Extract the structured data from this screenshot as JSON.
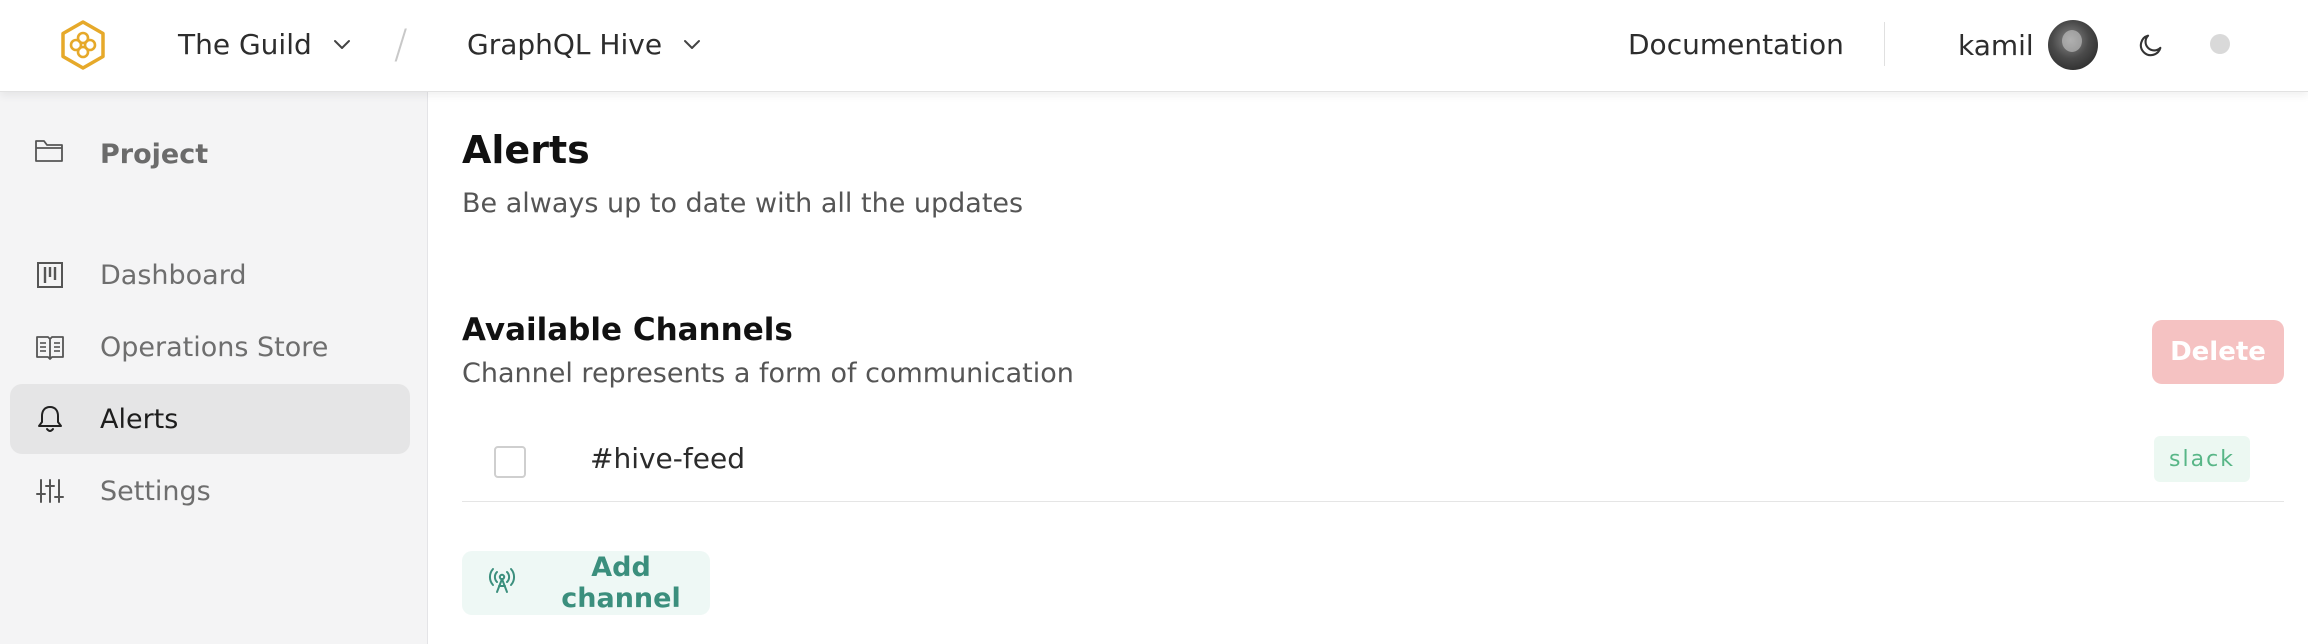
{
  "header": {
    "organization": "The Guild",
    "separator": "/",
    "project": "GraphQL Hive",
    "documentation_link": "Documentation",
    "username": "kamil"
  },
  "sidebar": {
    "section_title": "Project",
    "items": [
      {
        "label": "Dashboard",
        "icon": "dashboard-icon",
        "active": false
      },
      {
        "label": "Operations Store",
        "icon": "book-icon",
        "active": false
      },
      {
        "label": "Alerts",
        "icon": "bell-icon",
        "active": true
      },
      {
        "label": "Settings",
        "icon": "sliders-icon",
        "active": false
      }
    ]
  },
  "main": {
    "title": "Alerts",
    "subtitle": "Be always up to date with all the updates",
    "channels_section": {
      "title": "Available Channels",
      "subtitle": "Channel represents a form of communication",
      "delete_label": "Delete",
      "channels": [
        {
          "name": "#hive-feed",
          "type": "slack",
          "checked": false
        }
      ],
      "add_label": "Add channel"
    }
  },
  "colors": {
    "brand": "#e6a92a",
    "active_nav_bg": "#e5e5e6",
    "delete_disabled_bg": "#f5c2c2",
    "badge_bg": "#ecf8f2",
    "badge_text": "#58b687",
    "add_button_text": "#3b8f7d"
  }
}
